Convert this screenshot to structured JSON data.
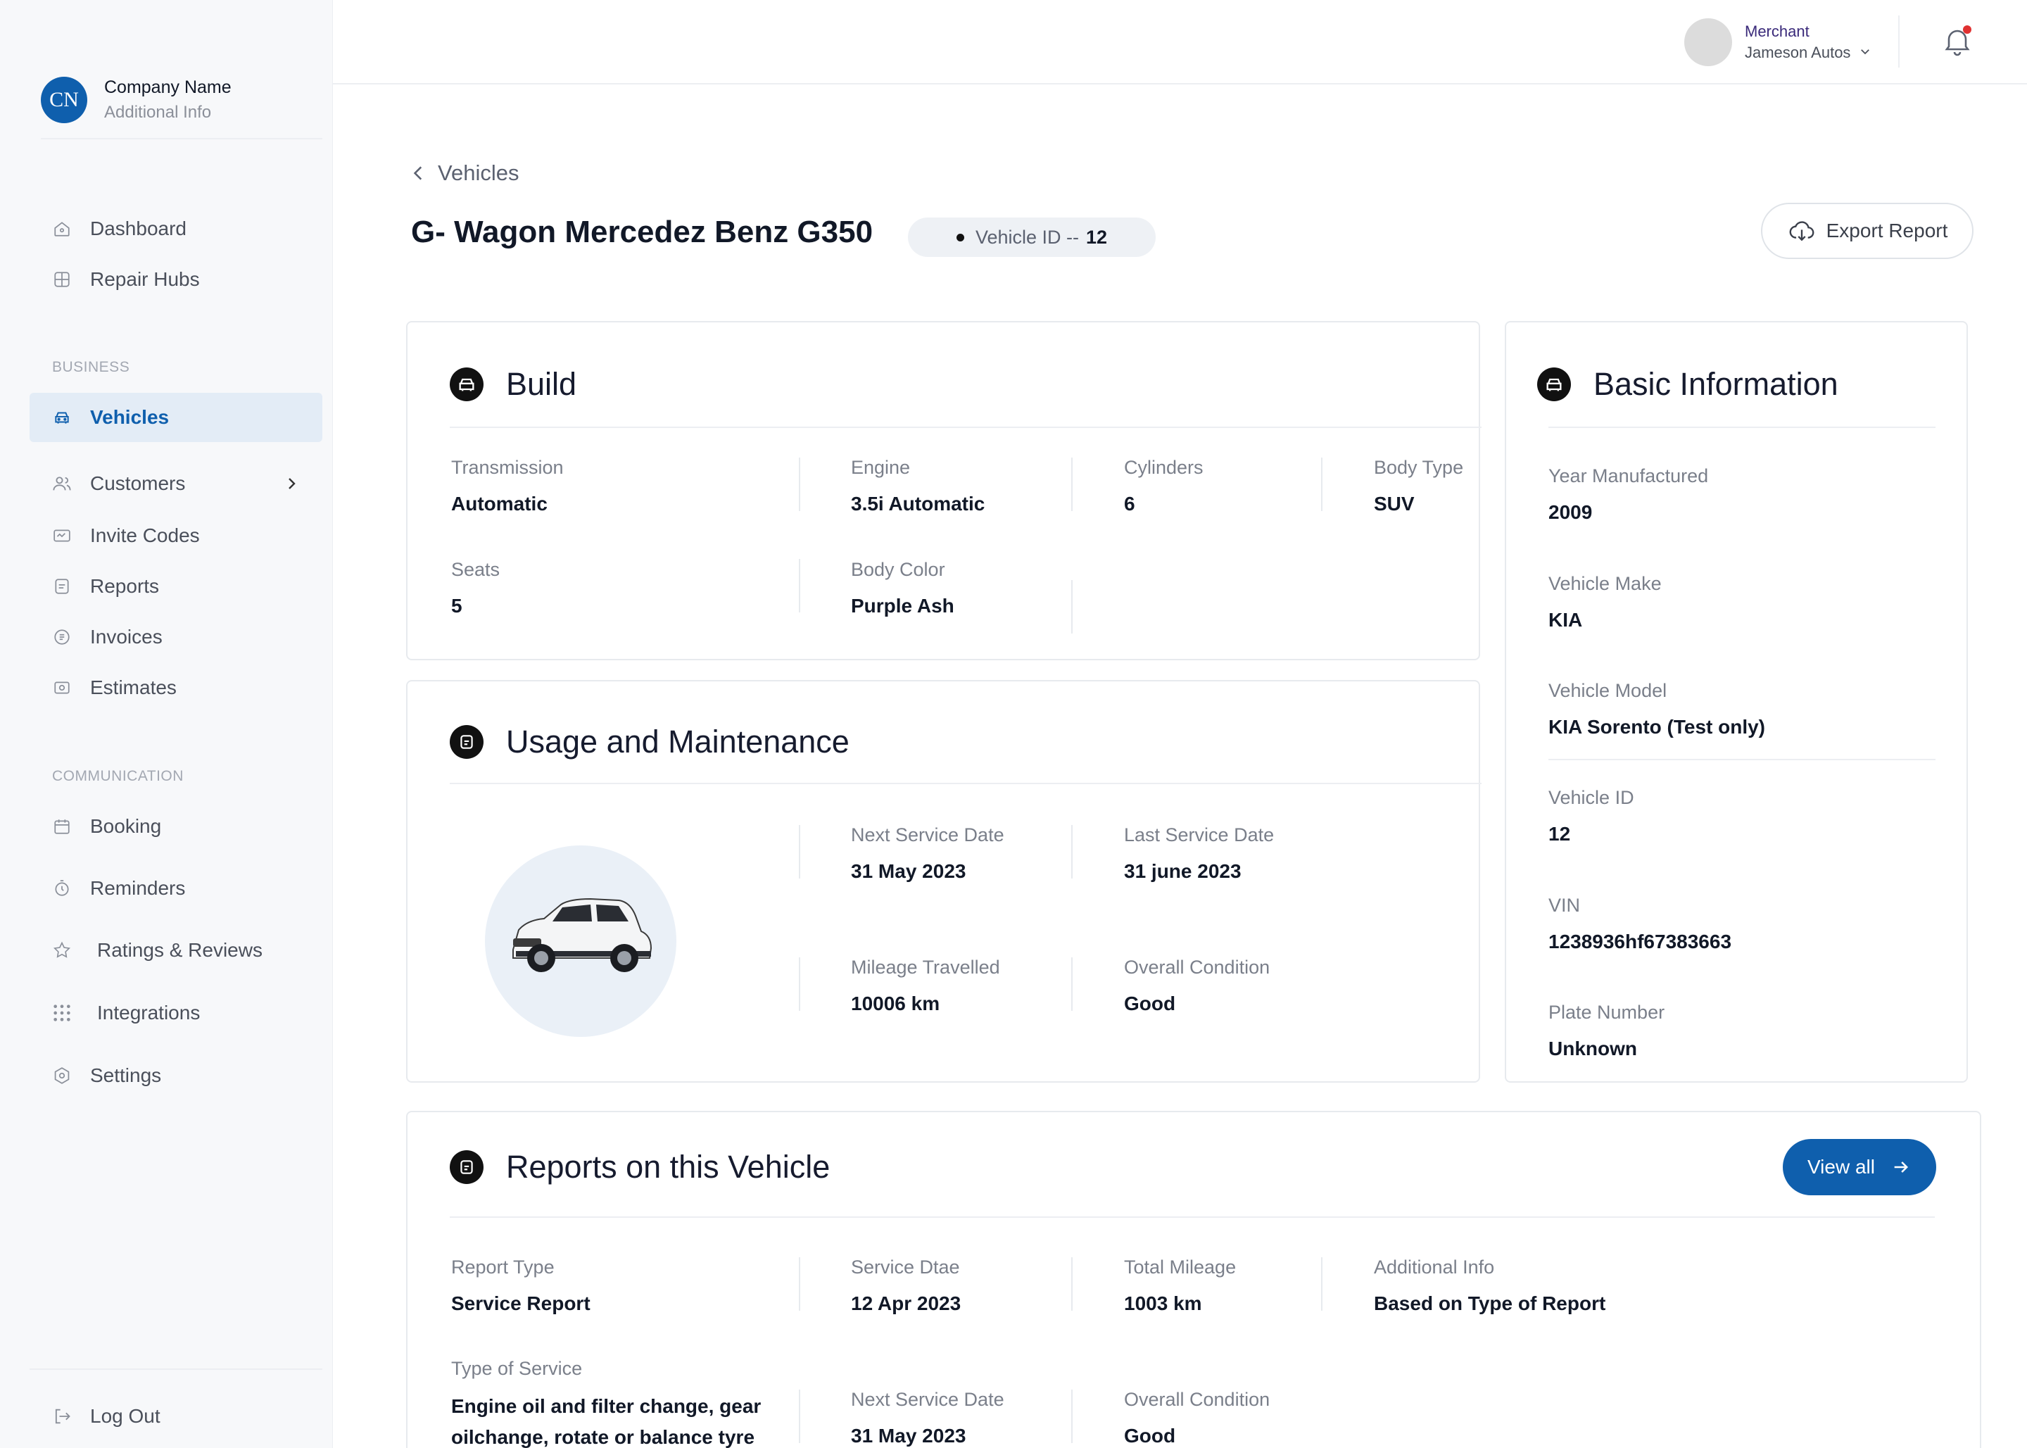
{
  "company": {
    "logo_initials": "CN",
    "name": "Company Name",
    "info": "Additional Info"
  },
  "sidebar": {
    "items_top": [
      {
        "label": "Dashboard",
        "icon": "home-icon"
      },
      {
        "label": "Repair Hubs",
        "icon": "building-icon"
      }
    ],
    "business_label": "BUSINESS",
    "items_business": [
      {
        "label": "Vehicles",
        "icon": "car-icon",
        "active": true
      },
      {
        "label": "Customers",
        "icon": "users-icon"
      },
      {
        "label": "Invite Codes",
        "icon": "ticket-icon"
      },
      {
        "label": "Reports",
        "icon": "report-icon"
      },
      {
        "label": "Invoices",
        "icon": "invoice-icon"
      },
      {
        "label": "Estimates",
        "icon": "estimate-icon"
      }
    ],
    "communication_label": "COMMUNICATION",
    "items_comm": [
      {
        "label": "Booking",
        "icon": "calendar-icon"
      },
      {
        "label": "Reminders",
        "icon": "clock-icon"
      },
      {
        "label": "Ratings & Reviews",
        "icon": "star-icon"
      },
      {
        "label": "Integrations",
        "icon": "grid-icon"
      },
      {
        "label": "Settings",
        "icon": "gear-icon"
      }
    ],
    "logout": "Log Out"
  },
  "header": {
    "role": "Merchant",
    "merchant_name": "Jameson Autos",
    "has_notification": true
  },
  "page": {
    "back_label": "Vehicles",
    "title": "G- Wagon Mercedez Benz G350",
    "vehicle_id_label": "Vehicle ID --",
    "vehicle_id_value": "12",
    "export_label": "Export Report"
  },
  "build": {
    "title": "Build",
    "transmission_label": "Transmission",
    "transmission": "Automatic",
    "engine_label": "Engine",
    "engine": "3.5i Automatic",
    "cylinders_label": "Cylinders",
    "cylinders": "6",
    "body_type_label": "Body Type",
    "body_type": "SUV",
    "seats_label": "Seats",
    "seats": "5",
    "body_color_label": "Body Color",
    "body_color": "Purple Ash"
  },
  "usage": {
    "title": "Usage and Maintenance",
    "next_service_label": "Next Service Date",
    "next_service": "31 May 2023",
    "last_service_label": "Last Service Date",
    "last_service": "31 june 2023",
    "mileage_label": "Mileage Travelled",
    "mileage": "10006 km",
    "condition_label": "Overall Condition",
    "condition": "Good"
  },
  "basic": {
    "title": "Basic Information",
    "year_label": "Year Manufactured",
    "year": "2009",
    "make_label": "Vehicle Make",
    "make": "KIA",
    "model_label": "Vehicle Model",
    "model": "KIA Sorento (Test only)",
    "id_label": "Vehicle ID",
    "id": "12",
    "vin_label": "VIN",
    "vin": "1238936hf67383663",
    "plate_label": "Plate Number",
    "plate": "Unknown"
  },
  "reports": {
    "title": "Reports on this Vehicle",
    "view_all": "View all",
    "report_type_label": "Report Type",
    "report_type": "Service Report",
    "service_date_label": "Service Dtae",
    "service_date": "12 Apr 2023",
    "total_mileage_label": "Total Mileage",
    "total_mileage": "1003 km",
    "additional_label": "Additional Info",
    "additional": "Based on Type of Report",
    "type_of_service_label": "Type of Service",
    "type_of_service_line1": "Engine oil and filter change, gear",
    "type_of_service_line2": "oilchange, rotate or balance tyre",
    "next_service_label": "Next Service Date",
    "next_service": "31 May 2023",
    "condition_label": "Overall Condition",
    "condition": "Good"
  },
  "colors": {
    "accent": "#0f5fad",
    "active_bg": "#e3ecf6",
    "sidebar_bg": "#f7f8fa"
  }
}
